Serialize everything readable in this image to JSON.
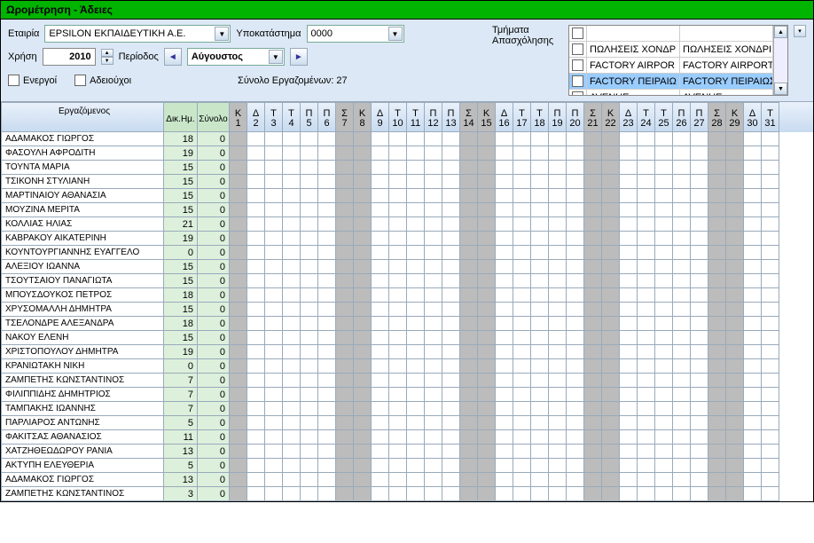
{
  "title": "Ωρομέτρηση - Άδειες",
  "labels": {
    "company": "Εταιρία",
    "branch": "Υποκατάστημα",
    "year": "Χρήση",
    "period": "Περίοδος",
    "active": "Ενεργοί",
    "holders": "Αδειούχοι",
    "departments": "Τμήματα Απασχόλησης",
    "total_employees": "Σύνολο Εργαζομένων: 27"
  },
  "filters": {
    "company": "EPSILON ΕΚΠΑΙΔΕΥΤΙΚΗ Α.Ε.",
    "branch": "0000",
    "year": "2010",
    "period": "Αύγουστος"
  },
  "departments": [
    {
      "c1": "ΠΩΛΗΣΕΙΣ ΧΟΝΔΡ",
      "c2": "ΠΩΛΗΣΕΙΣ ΧΟΝΔΡΙΚΗ",
      "sel": false
    },
    {
      "c1": "FACTORY AIRPOR",
      "c2": "FACTORY AIRPORT",
      "sel": false
    },
    {
      "c1": "FACTORY ΠΕΙΡΑΙΩ",
      "c2": "FACTORY ΠΕΙΡΑΙΩΣ",
      "sel": true
    },
    {
      "c1": "AVENUE",
      "c2": "AVENUE",
      "sel": false
    }
  ],
  "columns": {
    "name": "Εργαζόμενος",
    "dik": "Δικ.Ημ.",
    "syn": "Σύνολο"
  },
  "days": [
    {
      "w": "Κ",
      "d": "1",
      "wk": true
    },
    {
      "w": "Δ",
      "d": "2"
    },
    {
      "w": "Τ",
      "d": "3"
    },
    {
      "w": "Τ",
      "d": "4"
    },
    {
      "w": "Π",
      "d": "5"
    },
    {
      "w": "Π",
      "d": "6"
    },
    {
      "w": "Σ",
      "d": "7",
      "wk": true
    },
    {
      "w": "Κ",
      "d": "8",
      "wk": true
    },
    {
      "w": "Δ",
      "d": "9"
    },
    {
      "w": "Τ",
      "d": "10"
    },
    {
      "w": "Τ",
      "d": "11"
    },
    {
      "w": "Π",
      "d": "12"
    },
    {
      "w": "Π",
      "d": "13"
    },
    {
      "w": "Σ",
      "d": "14",
      "wk": true
    },
    {
      "w": "Κ",
      "d": "15",
      "wk": true
    },
    {
      "w": "Δ",
      "d": "16"
    },
    {
      "w": "Τ",
      "d": "17"
    },
    {
      "w": "Τ",
      "d": "18"
    },
    {
      "w": "Π",
      "d": "19"
    },
    {
      "w": "Π",
      "d": "20"
    },
    {
      "w": "Σ",
      "d": "21",
      "wk": true
    },
    {
      "w": "Κ",
      "d": "22",
      "wk": true
    },
    {
      "w": "Δ",
      "d": "23"
    },
    {
      "w": "Τ",
      "d": "24"
    },
    {
      "w": "Τ",
      "d": "25"
    },
    {
      "w": "Π",
      "d": "26"
    },
    {
      "w": "Π",
      "d": "27"
    },
    {
      "w": "Σ",
      "d": "28",
      "wk": true
    },
    {
      "w": "Κ",
      "d": "29",
      "wk": true
    },
    {
      "w": "Δ",
      "d": "30"
    },
    {
      "w": "Τ",
      "d": "31"
    }
  ],
  "rows": [
    {
      "name": "ΑΔΑΜΑΚΟΣ ΓΙΩΡΓΟΣ",
      "dik": 18,
      "syn": 0
    },
    {
      "name": "ΦΑΣΟΥΛΗ ΑΦΡΟΔΙΤΗ",
      "dik": 19,
      "syn": 0
    },
    {
      "name": "ΤΟΥΝΤΑ ΜΑΡΙΑ",
      "dik": 15,
      "syn": 0
    },
    {
      "name": "ΤΣΙΚΟΝΗ ΣΤΥΛΙΑΝΗ",
      "dik": 15,
      "syn": 0
    },
    {
      "name": "ΜΑΡΤΙΝΑΙΟΥ ΑΘΑΝΑΣΙΑ",
      "dik": 15,
      "syn": 0
    },
    {
      "name": "ΜΟΥΖΙΝΑ ΜΕΡΙΤΑ",
      "dik": 15,
      "syn": 0
    },
    {
      "name": "ΚΟΛΛΙΑΣ ΗΛΙΑΣ",
      "dik": 21,
      "syn": 0
    },
    {
      "name": "ΚΑΒΡΑΚΟΥ ΑΙΚΑΤΕΡΙΝΗ",
      "dik": 19,
      "syn": 0
    },
    {
      "name": "ΚΟΥΝΤΟΥΡΓΙΑΝΝΗΣ ΕΥΑΓΓΕΛΟ",
      "dik": 0,
      "syn": 0
    },
    {
      "name": "ΑΛΕΞΙΟΥ ΙΩΑΝΝΑ",
      "dik": 15,
      "syn": 0
    },
    {
      "name": "ΤΣΟΥΤΣΑΙΟΥ ΠΑΝΑΓΙΩΤΑ",
      "dik": 15,
      "syn": 0
    },
    {
      "name": "ΜΠΟΥΣΔΟΥΚΟΣ ΠΕΤΡΟΣ",
      "dik": 18,
      "syn": 0
    },
    {
      "name": "ΧΡΥΣΟΜΑΛΛΗ ΔΗΜΗΤΡΑ",
      "dik": 15,
      "syn": 0
    },
    {
      "name": "ΤΣΕΛΟΝΔΡΕ ΑΛΕΞΑΝΔΡΑ",
      "dik": 18,
      "syn": 0
    },
    {
      "name": "ΝΑΚΟΥ ΕΛΕΝΗ",
      "dik": 15,
      "syn": 0
    },
    {
      "name": "ΧΡΙΣΤΟΠΟΥΛΟΥ ΔΗΜΗΤΡΑ",
      "dik": 19,
      "syn": 0
    },
    {
      "name": "ΚΡΑΝΙΩΤΑΚΗ ΝΙΚΗ",
      "dik": 0,
      "syn": 0
    },
    {
      "name": "ΖΑΜΠΕΤΗΣ ΚΩΝΣΤΑΝΤΙΝΟΣ",
      "dik": 7,
      "syn": 0
    },
    {
      "name": "ΦΙΛΙΠΠΙΔΗΣ ΔΗΜΗΤΡΙΟΣ",
      "dik": 7,
      "syn": 0
    },
    {
      "name": "ΤΑΜΠΑΚΗΣ ΙΩΑΝΝΗΣ",
      "dik": 7,
      "syn": 0
    },
    {
      "name": "ΠΑΡΛΙΑΡΟΣ ΑΝΤΩΝΗΣ",
      "dik": 5,
      "syn": 0
    },
    {
      "name": "ΦΑΚΙΤΣΑΣ ΑΘΑΝΑΣΙΟΣ",
      "dik": 11,
      "syn": 0
    },
    {
      "name": "ΧΑΤΖΗΘΕΩΔΩΡΟΥ ΡΑΝΙΑ",
      "dik": 13,
      "syn": 0
    },
    {
      "name": "ΑΚΤΥΠΗ ΕΛΕΥΘΕΡΙΑ",
      "dik": 5,
      "syn": 0
    },
    {
      "name": "ΑΔΑΜΑΚΟΣ ΓΙΩΡΓΟΣ",
      "dik": 13,
      "syn": 0
    },
    {
      "name": "ΖΑΜΠΕΤΗΣ ΚΩΝΣΤΑΝΤΙΝΟΣ",
      "dik": 3,
      "syn": 0
    }
  ]
}
